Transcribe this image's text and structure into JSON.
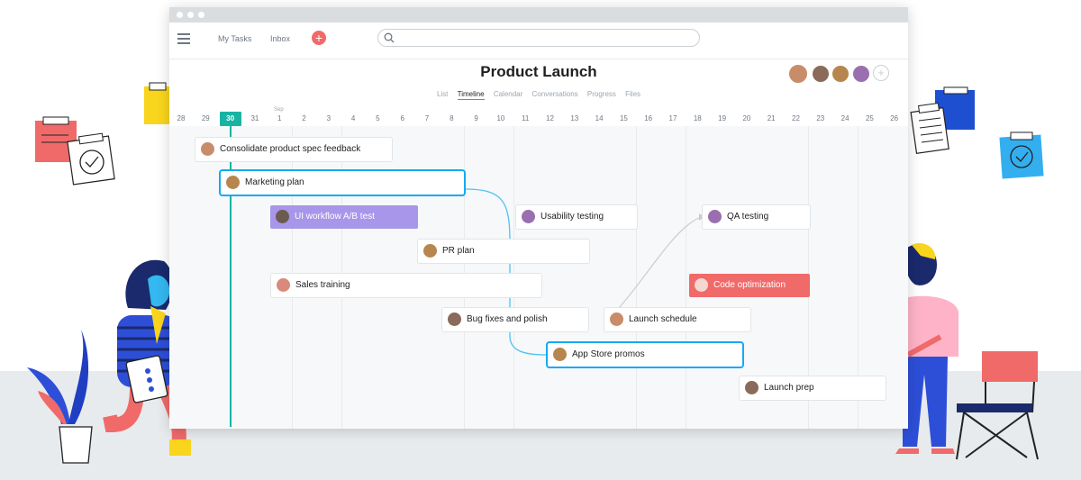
{
  "toolbar": {
    "my_tasks": "My Tasks",
    "inbox": "Inbox",
    "add_symbol": "+",
    "search_placeholder": ""
  },
  "project": {
    "title": "Product Launch",
    "add_member_symbol": "+"
  },
  "tabs": [
    {
      "label": "List",
      "active": false
    },
    {
      "label": "Timeline",
      "active": true
    },
    {
      "label": "Calendar",
      "active": false
    },
    {
      "label": "Conversations",
      "active": false
    },
    {
      "label": "Progress",
      "active": false
    },
    {
      "label": "Files",
      "active": false
    }
  ],
  "timeline": {
    "month_label": "Sep",
    "today": "30",
    "dates": [
      "28",
      "29",
      "30",
      "31",
      "1",
      "2",
      "3",
      "4",
      "5",
      "6",
      "7",
      "8",
      "9",
      "10",
      "11",
      "12",
      "13",
      "14",
      "15",
      "16",
      "17",
      "18",
      "19",
      "20",
      "21",
      "22",
      "23",
      "24",
      "25",
      "26"
    ]
  },
  "tasks": [
    {
      "label": "Consolidate product spec feedback",
      "style": "normal"
    },
    {
      "label": "Marketing plan",
      "style": "selected"
    },
    {
      "label": "UI workflow A/B test",
      "style": "purple"
    },
    {
      "label": "Usability testing",
      "style": "normal"
    },
    {
      "label": "QA testing",
      "style": "normal"
    },
    {
      "label": "PR plan",
      "style": "normal"
    },
    {
      "label": "Sales training",
      "style": "normal"
    },
    {
      "label": "Code optimization",
      "style": "red"
    },
    {
      "label": "Bug fixes and polish",
      "style": "normal"
    },
    {
      "label": "Launch schedule",
      "style": "normal"
    },
    {
      "label": "App Store promos",
      "style": "selected"
    },
    {
      "label": "Launch prep",
      "style": "normal"
    }
  ],
  "colors": {
    "accent": "#14aaf5",
    "today": "#19b3a3",
    "add_button": "#f06a6a",
    "purple_task": "#a796ea",
    "red_task": "#f06a6a"
  },
  "icons": [
    "menu-icon",
    "plus-icon",
    "search-icon",
    "user-avatar-icon",
    "sticky-note-icon",
    "checklist-icon"
  ]
}
